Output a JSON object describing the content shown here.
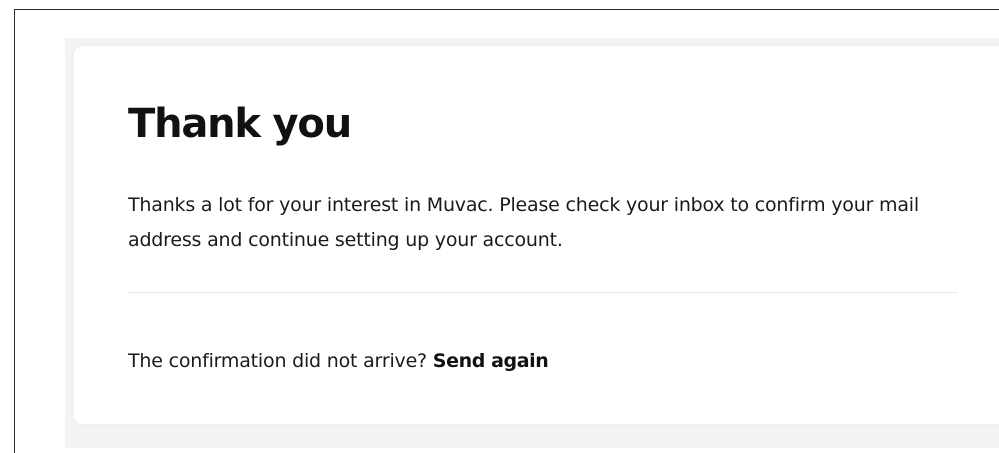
{
  "card": {
    "title": "Thank you",
    "message": "Thanks a lot for your interest in Muvac. Please check your inbox to confirm your mail address and continue setting up your account.",
    "resend_prompt": "The confirmation did not arrive?",
    "resend_link": "Send again"
  }
}
